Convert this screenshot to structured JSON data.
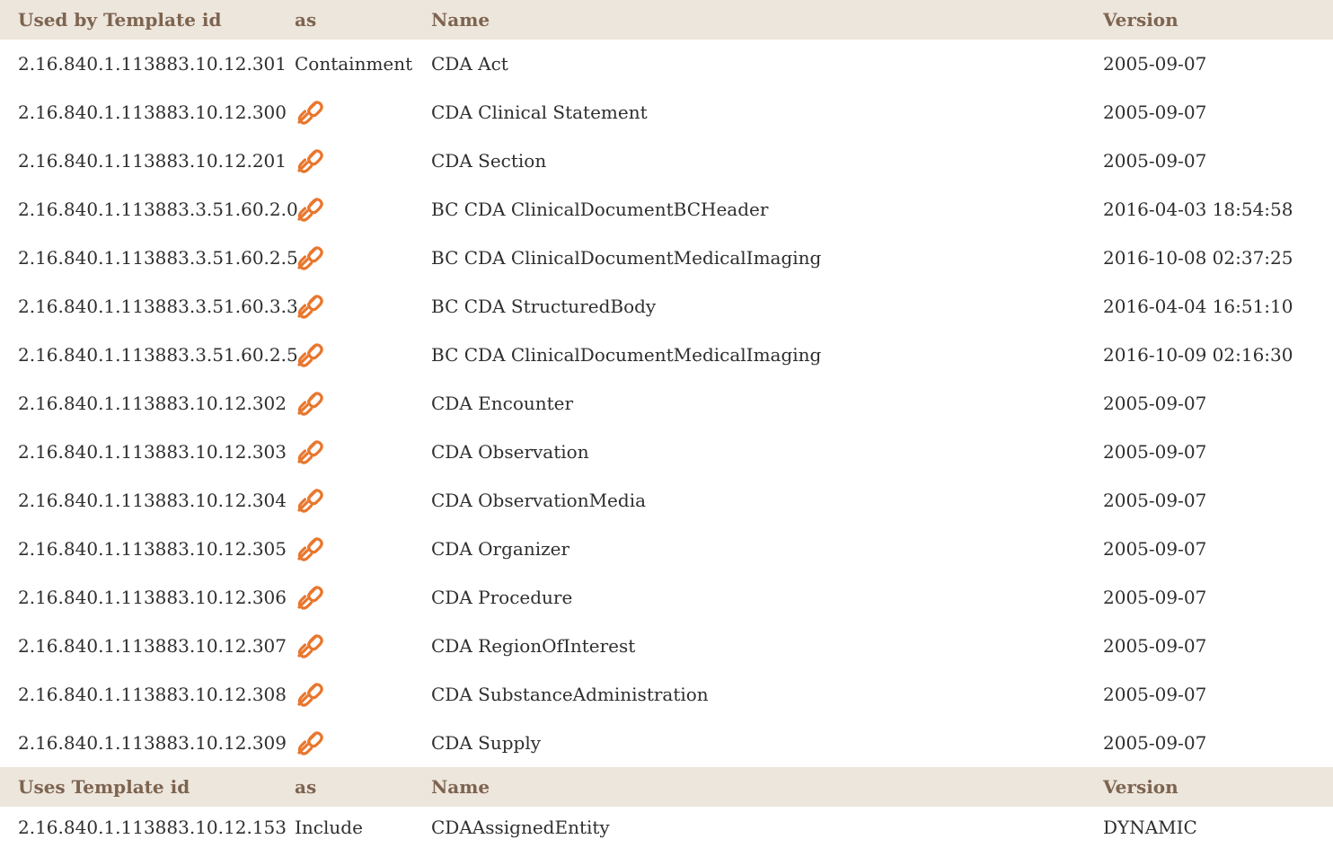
{
  "used_by": {
    "headers": {
      "template_id": "Used by Template id",
      "as": "as",
      "name": "Name",
      "version": "Version"
    },
    "rows": [
      {
        "template_id": "2.16.840.1.113883.10.12.301",
        "as": "Containment",
        "name": "CDA Act",
        "version": "2005-09-07"
      },
      {
        "template_id": "2.16.840.1.113883.10.12.300",
        "as_icon": "link-icon",
        "name": "CDA Clinical Statement",
        "version": "2005-09-07"
      },
      {
        "template_id": "2.16.840.1.113883.10.12.201",
        "as_icon": "link-icon",
        "name": "CDA Section",
        "version": "2005-09-07"
      },
      {
        "template_id": "2.16.840.1.113883.3.51.60.2.0",
        "as_icon": "link-icon",
        "name": "BC CDA ClinicalDocumentBCHeader",
        "version": "2016-04-03 18:54:58"
      },
      {
        "template_id": "2.16.840.1.113883.3.51.60.2.5",
        "as_icon": "link-icon",
        "name": "BC CDA ClinicalDocumentMedicalImaging",
        "version": "2016-10-08 02:37:25"
      },
      {
        "template_id": "2.16.840.1.113883.3.51.60.3.3",
        "as_icon": "link-icon",
        "name": "BC CDA StructuredBody",
        "version": "2016-04-04 16:51:10"
      },
      {
        "template_id": "2.16.840.1.113883.3.51.60.2.5",
        "as_icon": "link-icon",
        "name": "BC CDA ClinicalDocumentMedicalImaging",
        "version": "2016-10-09 02:16:30"
      },
      {
        "template_id": "2.16.840.1.113883.10.12.302",
        "as_icon": "link-icon",
        "name": "CDA Encounter",
        "version": "2005-09-07"
      },
      {
        "template_id": "2.16.840.1.113883.10.12.303",
        "as_icon": "link-icon",
        "name": "CDA Observation",
        "version": "2005-09-07"
      },
      {
        "template_id": "2.16.840.1.113883.10.12.304",
        "as_icon": "link-icon",
        "name": "CDA ObservationMedia",
        "version": "2005-09-07"
      },
      {
        "template_id": "2.16.840.1.113883.10.12.305",
        "as_icon": "link-icon",
        "name": "CDA Organizer",
        "version": "2005-09-07"
      },
      {
        "template_id": "2.16.840.1.113883.10.12.306",
        "as_icon": "link-icon",
        "name": "CDA Procedure",
        "version": "2005-09-07"
      },
      {
        "template_id": "2.16.840.1.113883.10.12.307",
        "as_icon": "link-icon",
        "name": "CDA RegionOfInterest",
        "version": "2005-09-07"
      },
      {
        "template_id": "2.16.840.1.113883.10.12.308",
        "as_icon": "link-icon",
        "name": "CDA SubstanceAdministration",
        "version": "2005-09-07"
      },
      {
        "template_id": "2.16.840.1.113883.10.12.309",
        "as_icon": "link-icon",
        "name": "CDA Supply",
        "version": "2005-09-07"
      }
    ]
  },
  "uses": {
    "headers": {
      "template_id": "Uses Template id",
      "as": "as",
      "name": "Name",
      "version": "Version"
    },
    "rows": [
      {
        "template_id": "2.16.840.1.113883.10.12.153",
        "as": "Include",
        "name": "CDAAssignedEntity",
        "version": "DYNAMIC"
      }
    ]
  },
  "colors": {
    "header_background": "#ede6dc",
    "header_text": "#7d6450",
    "link_icon": "#e8772e"
  }
}
